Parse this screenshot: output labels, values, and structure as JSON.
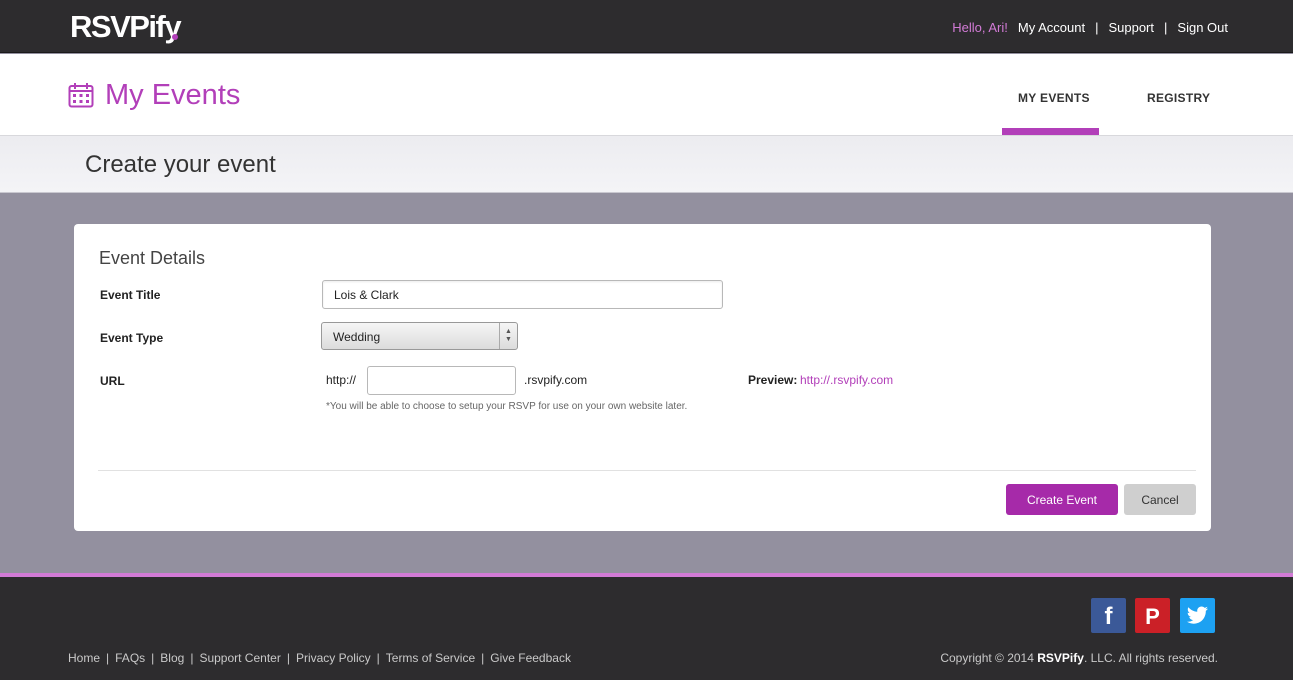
{
  "brand": {
    "name": "RSVPify",
    "accent": "#b23fb9"
  },
  "topnav": {
    "greeting": "Hello, Ari!",
    "my_account": "My Account",
    "support": "Support",
    "sign_out": "Sign Out",
    "sep": "|"
  },
  "header": {
    "title": "My Events",
    "icon": "calendar-icon",
    "tabs": [
      {
        "label": "MY EVENTS",
        "active": true
      },
      {
        "label": "REGISTRY",
        "active": false
      }
    ]
  },
  "subheader": {
    "title": "Create your event"
  },
  "form": {
    "section_title": "Event Details",
    "event_title_label": "Event Title",
    "event_title_value": "Lois & Clark",
    "event_type_label": "Event Type",
    "event_type_value": "Wedding",
    "url_label": "URL",
    "url_prefix": "http://",
    "url_value": "",
    "url_suffix": ".rsvpify.com",
    "note": "*You will be able to choose to setup your RSVP for use on your own website later.",
    "preview_label": "Preview:",
    "preview_link": "http://.rsvpify.com"
  },
  "actions": {
    "create": "Create Event",
    "cancel": "Cancel"
  },
  "footer": {
    "social": [
      {
        "name": "facebook-icon",
        "glyph": "f"
      },
      {
        "name": "pinterest-icon",
        "glyph": "P"
      },
      {
        "name": "twitter-icon",
        "glyph": ""
      }
    ],
    "links": [
      "Home",
      "FAQs",
      "Blog",
      "Support Center",
      "Privacy Policy",
      "Terms of Service",
      "Give Feedback"
    ],
    "link_sep": "|",
    "copyright_prefix": "Copyright © 2014",
    "copyright_brand": "RSVPify",
    "copyright_suffix": ". LLC. All rights reserved."
  }
}
